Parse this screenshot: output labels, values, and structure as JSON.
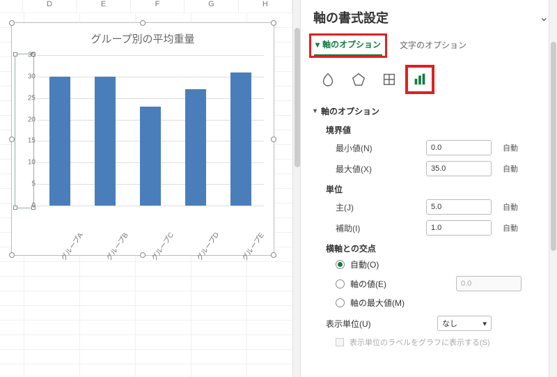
{
  "columns": [
    "D",
    "E",
    "F",
    "G",
    "H"
  ],
  "chart_data": {
    "type": "bar",
    "title": "グループ別の平均重量",
    "categories": [
      "グループA",
      "グループB",
      "グループC",
      "グループD",
      "グループE"
    ],
    "values": [
      30,
      30,
      23,
      27,
      31
    ],
    "xlabel": "",
    "ylabel": "",
    "ylim": [
      0,
      35
    ],
    "y_tick_step": 5,
    "y_ticks": [
      0,
      5,
      10,
      15,
      20,
      25,
      30,
      35
    ]
  },
  "pane": {
    "title": "軸の書式設定",
    "tabs": {
      "axis_options": "軸のオプション",
      "text_options": "文字のオプション"
    },
    "section": {
      "header": "軸のオプション",
      "bounds_label": "境界値",
      "min_label": "最小値(N)",
      "min_value": "0.0",
      "min_state": "自動",
      "max_label": "最大値(X)",
      "max_value": "35.0",
      "max_state": "自動",
      "units_label": "単位",
      "major_label": "主(J)",
      "major_value": "5.0",
      "major_state": "自動",
      "minor_label": "補助(I)",
      "minor_value": "1.0",
      "minor_state": "自動",
      "cross_label": "横軸との交点",
      "cross_auto": "自動(O)",
      "cross_value_label": "軸の値(E)",
      "cross_value": "0.0",
      "cross_max_label": "軸の最大値(M)",
      "display_units_label": "表示単位(U)",
      "display_units_value": "なし",
      "show_units_label_on_chart": "表示単位のラベルをグラフに表示する(S)"
    }
  }
}
